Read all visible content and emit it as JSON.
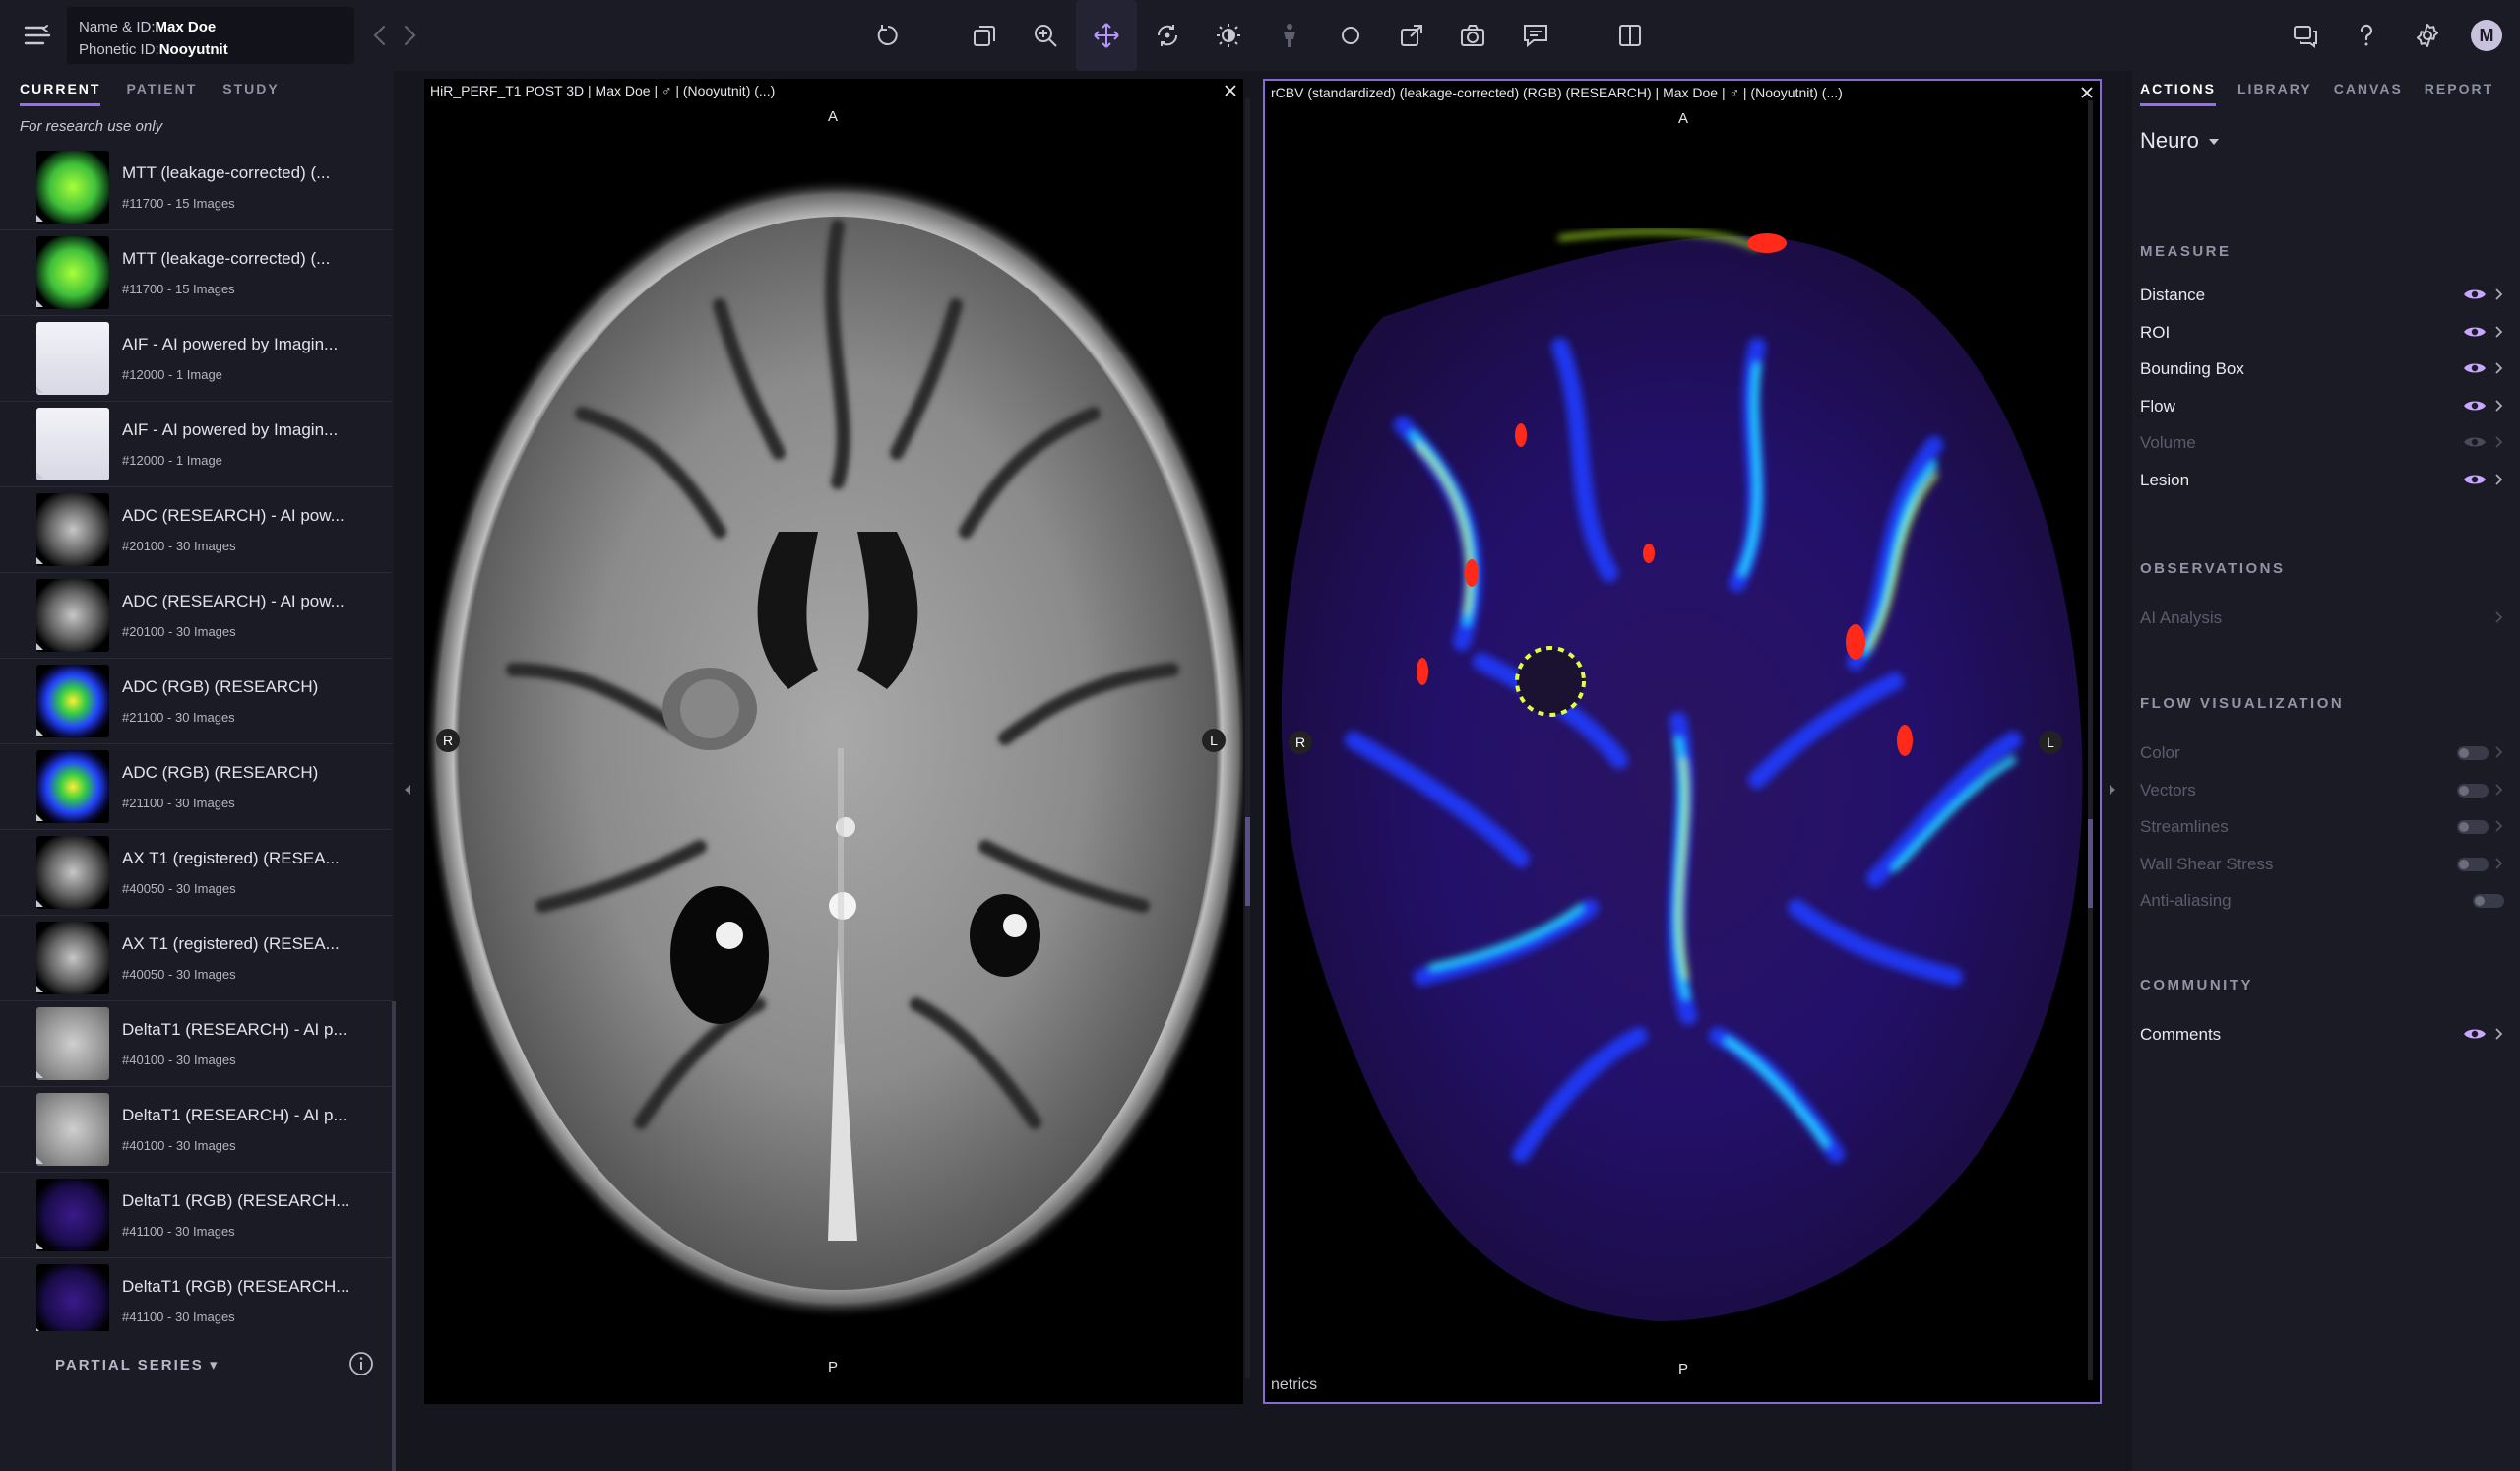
{
  "patient": {
    "name_label": "Name & ID:",
    "name_value": "Max Doe",
    "phonetic_label": "Phonetic ID:",
    "phonetic_value": "Nooyutnit"
  },
  "toolbar": {
    "tools": [
      "reset-icon",
      "layers-icon",
      "zoom-icon",
      "pan-icon",
      "rotate-icon",
      "brightness-icon",
      "anatomy-icon",
      "ellipse-icon",
      "export-icon",
      "camera-icon",
      "comment-icon",
      "split-view-icon"
    ],
    "active_tool": "pan-icon",
    "right_icons": [
      "chat-icon",
      "help-icon",
      "settings-icon"
    ],
    "avatar_initial": "M"
  },
  "left_panel": {
    "tabs": [
      {
        "label": "CURRENT",
        "active": true
      },
      {
        "label": "PATIENT",
        "active": false
      },
      {
        "label": "STUDY",
        "active": false
      }
    ],
    "research_note": "For research use only",
    "series": [
      {
        "title": "MTT (leakage-corrected) (...",
        "sub": "#11700 - 15 Images",
        "thumb": "green"
      },
      {
        "title": "MTT (leakage-corrected) (...",
        "sub": "#11700 - 15 Images",
        "thumb": "green"
      },
      {
        "title": "AIF - AI powered by Imagin...",
        "sub": "#12000 - 1 Image",
        "thumb": "chart"
      },
      {
        "title": "AIF - AI powered by Imagin...",
        "sub": "#12000 - 1 Image",
        "thumb": "chart"
      },
      {
        "title": "ADC (RESEARCH) - AI pow...",
        "sub": "#20100 - 30 Images",
        "thumb": "gray-dark"
      },
      {
        "title": "ADC (RESEARCH) - AI pow...",
        "sub": "#20100 - 30 Images",
        "thumb": "gray-dark"
      },
      {
        "title": "ADC (RGB) (RESEARCH)",
        "sub": "#21100 - 30 Images",
        "thumb": "rgb"
      },
      {
        "title": "ADC (RGB) (RESEARCH)",
        "sub": "#21100 - 30 Images",
        "thumb": "rgb"
      },
      {
        "title": "AX T1 (registered) (RESEA...",
        "sub": "#40050 - 30 Images",
        "thumb": "gray-dark"
      },
      {
        "title": "AX T1 (registered) (RESEA...",
        "sub": "#40050 - 30 Images",
        "thumb": "gray-dark"
      },
      {
        "title": "DeltaT1 (RESEARCH) - AI p...",
        "sub": "#40100 - 30 Images",
        "thumb": "gray-light"
      },
      {
        "title": "DeltaT1 (RESEARCH) - AI p...",
        "sub": "#40100 - 30 Images",
        "thumb": "gray-light"
      },
      {
        "title": "DeltaT1 (RGB) (RESEARCH...",
        "sub": "#41100 - 30 Images",
        "thumb": "dark-rgb"
      },
      {
        "title": "DeltaT1 (RGB) (RESEARCH...",
        "sub": "#41100 - 30 Images",
        "thumb": "dark-rgb"
      }
    ],
    "partial_series_label": "PARTIAL SERIES ▾"
  },
  "viewport1": {
    "header": "HiR_PERF_T1 POST 3D | Max Doe | ♂ | (Nooyutnit)  (...)",
    "top": "A",
    "bottom": "P",
    "left": "R",
    "right": "L"
  },
  "viewport2": {
    "header": "rCBV (standardized) (leakage-corrected) (RGB) (RESEARCH) | Max Doe | ♂ | (Nooyutnit)  (...)",
    "top": "A",
    "bottom": "P",
    "left": "R",
    "right": "L",
    "footer": "netrics"
  },
  "right_panel": {
    "tabs": [
      {
        "label": "ACTIONS",
        "active": true
      },
      {
        "label": "LIBRARY",
        "active": false
      },
      {
        "label": "CANVAS",
        "active": false
      },
      {
        "label": "REPORT",
        "active": false
      }
    ],
    "module": "Neuro",
    "sections": {
      "measure": "MEASURE",
      "observations": "OBSERVATIONS",
      "flow_visualization": "FLOW VISUALIZATION",
      "community": "COMMUNITY"
    },
    "measure_items": [
      {
        "label": "Distance",
        "enabled": true
      },
      {
        "label": "ROI",
        "enabled": true
      },
      {
        "label": "Bounding Box",
        "enabled": true
      },
      {
        "label": "Flow",
        "enabled": true
      },
      {
        "label": "Volume",
        "enabled": false
      },
      {
        "label": "Lesion",
        "enabled": true
      }
    ],
    "observation_items": [
      {
        "label": "AI Analysis",
        "enabled": false
      }
    ],
    "flow_items": [
      {
        "label": "Color",
        "enabled": false,
        "chevron": true
      },
      {
        "label": "Vectors",
        "enabled": false,
        "chevron": true
      },
      {
        "label": "Streamlines",
        "enabled": false,
        "chevron": true
      },
      {
        "label": "Wall Shear Stress",
        "enabled": false,
        "chevron": true
      },
      {
        "label": "Anti-aliasing",
        "enabled": false,
        "chevron": false
      }
    ],
    "community_items": [
      {
        "label": "Comments",
        "enabled": true
      }
    ]
  },
  "colors": {
    "accent": "#9a6cf0",
    "eye_active": "#c9a7ff",
    "background": "#16161f",
    "panel": "#1b1b26"
  }
}
